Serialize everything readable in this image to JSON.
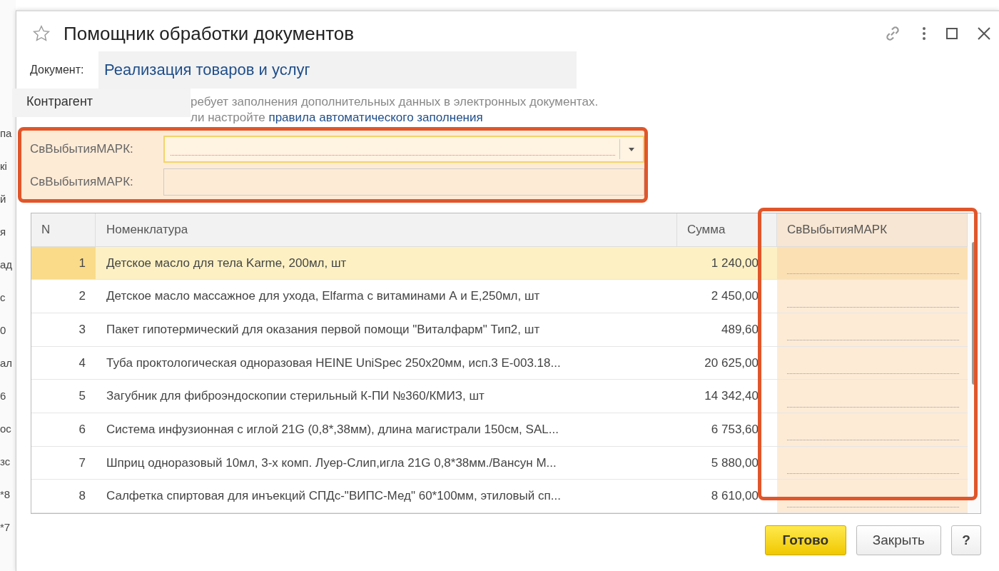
{
  "background_fragments": [
    "па",
    "кі",
    "й",
    "я",
    "ад",
    "с",
    "0",
    "ал",
    "6",
    "ос",
    "зс",
    "*8",
    "*7"
  ],
  "window": {
    "title": "Помощник обработки документов",
    "favorite": false
  },
  "document": {
    "label": "Документ:",
    "value": "Реализация товаров и услуг"
  },
  "popup": {
    "label": "Контрагент"
  },
  "message": {
    "line1": "ребует заполнения дополнительных данных в электронных документах.",
    "line2": "ли настройте ",
    "link": "правила автоматического заполнения"
  },
  "fields": [
    {
      "label": "СвВыбытияМАРК:",
      "kind": "dropdown",
      "focused": true
    },
    {
      "label": "СвВыбытияМАРК:",
      "kind": "text",
      "focused": false
    }
  ],
  "table": {
    "columns": [
      "N",
      "Номенклатура",
      "Сумма",
      "СвВыбытияМАРК"
    ],
    "rows": [
      {
        "n": "1",
        "name": "Детское масло для тела Karme, 200мл, шт",
        "sum": "1 240,00",
        "selected": true
      },
      {
        "n": "2",
        "name": "Детское масло массажное для ухода, Elfarma с витаминами А и Е,250мл, шт",
        "sum": "2 450,00",
        "selected": false
      },
      {
        "n": "3",
        "name": "Пакет гипотермический для оказания первой помощи \"Виталфарм\" Тип2, шт",
        "sum": "489,60",
        "selected": false
      },
      {
        "n": "4",
        "name": "Туба проктологическая одноразовая HEINE UniSpec 250x20мм, исп.3 Е-003.18...",
        "sum": "20 625,00",
        "selected": false
      },
      {
        "n": "5",
        "name": "Загубник для фиброэндоскопии стерильный К-ПИ №360/КМИЗ, шт",
        "sum": "14 342,40",
        "selected": false
      },
      {
        "n": "6",
        "name": "Система инфузионная с иглой 21G (0,8*,38мм), длина магистрали 150см, SAL...",
        "sum": "6 753,60",
        "selected": false
      },
      {
        "n": "7",
        "name": "Шприц одноразовый 10мл, 3-х комп. Луер-Слип,игла 21G 0,8*38мм./Вансун М...",
        "sum": "5 880,00",
        "selected": false
      },
      {
        "n": "8",
        "name": "Салфетка спиртовая для инъекций СПДс-\"ВИПС-Мед\" 60*100мм, этиловый сп...",
        "sum": "8 610,00",
        "selected": false
      }
    ]
  },
  "buttons": [
    {
      "label": "Готово",
      "kind": "primary"
    },
    {
      "label": "Закрыть",
      "kind": "normal"
    },
    {
      "label": "?",
      "kind": "help"
    }
  ]
}
